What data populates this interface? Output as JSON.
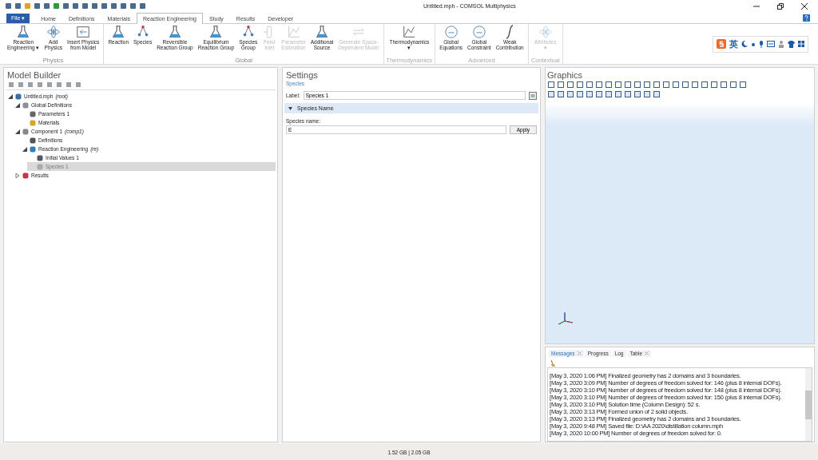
{
  "window": {
    "title": "Untitled.mph - COMSOL Multiphysics"
  },
  "file_button": "File ▾",
  "tabs": [
    {
      "label": "Home",
      "selected": false
    },
    {
      "label": "Definitions",
      "selected": false
    },
    {
      "label": "Materials",
      "selected": false
    },
    {
      "label": "Reaction Engineering",
      "selected": true
    },
    {
      "label": "Study",
      "selected": false
    },
    {
      "label": "Results",
      "selected": false
    },
    {
      "label": "Developer",
      "selected": false
    }
  ],
  "ribbon": [
    {
      "label": "Physics",
      "disabled": false,
      "buttons": [
        {
          "kind": "flask",
          "lines": [
            "Reaction",
            "Engineering ▾"
          ],
          "disabled": false
        },
        {
          "kind": "atom",
          "lines": [
            "Add",
            "Physics"
          ],
          "disabled": false
        },
        {
          "kind": "insert",
          "lines": [
            "Insert Physics",
            "from Model"
          ],
          "disabled": false
        }
      ]
    },
    {
      "label": "Global",
      "disabled": false,
      "buttons": [
        {
          "kind": "flask",
          "lines": [
            "Reaction"
          ],
          "disabled": false
        },
        {
          "kind": "nodes",
          "lines": [
            "Species"
          ],
          "disabled": false
        },
        {
          "kind": "flask",
          "lines": [
            "Reversible",
            "Reaction Group"
          ],
          "disabled": false
        },
        {
          "kind": "flask",
          "lines": [
            "Equilibrium",
            "Reaction Group"
          ],
          "disabled": false
        },
        {
          "kind": "nodes",
          "lines": [
            "Species",
            "Group"
          ],
          "disabled": false
        },
        {
          "kind": "inlet",
          "lines": [
            "Feed",
            "Inlet"
          ],
          "disabled": true
        },
        {
          "kind": "chart",
          "lines": [
            "Parameter",
            "Estimation"
          ],
          "disabled": true
        },
        {
          "kind": "flask",
          "lines": [
            "Additional",
            "Source"
          ],
          "disabled": false
        },
        {
          "kind": "swap",
          "lines": [
            "Generate Space-",
            "Dependent Model"
          ],
          "disabled": true
        }
      ]
    },
    {
      "label": "Thermodynamics",
      "disabled": true,
      "buttons": [
        {
          "kind": "chart",
          "lines": [
            "Thermodynamics",
            "▾"
          ],
          "disabled": false
        }
      ]
    },
    {
      "label": "Advanced",
      "disabled": true,
      "buttons": [
        {
          "kind": "circle",
          "lines": [
            "Global",
            "Equations"
          ],
          "disabled": false
        },
        {
          "kind": "circle",
          "lines": [
            "Global",
            "Constraint"
          ],
          "disabled": false
        },
        {
          "kind": "integral",
          "lines": [
            "Weak",
            "Contribution"
          ],
          "disabled": false
        }
      ]
    },
    {
      "label": "Contextual",
      "disabled": true,
      "buttons": [
        {
          "kind": "atom",
          "lines": [
            "Attributes",
            "▾"
          ],
          "disabled": true
        }
      ]
    }
  ],
  "ime_label": "英",
  "model_builder": {
    "title": "Model Builder",
    "tree": [
      {
        "label": "Untitled.mph",
        "tag": "(root)",
        "kind": "root",
        "selected": false,
        "expanded": true,
        "children": [
          {
            "label": "Global Definitions",
            "kind": "global",
            "selected": false,
            "expanded": true,
            "children": [
              {
                "label": "Parameters 1",
                "kind": "parameters",
                "selected": false
              },
              {
                "label": "Materials",
                "kind": "materials",
                "selected": false
              }
            ]
          },
          {
            "label": "Component 1",
            "tag": "(comp1)",
            "kind": "component",
            "selected": false,
            "expanded": true,
            "children": [
              {
                "label": "Definitions",
                "kind": "definitions",
                "selected": false
              },
              {
                "label": "Reaction Engineering",
                "tag": "(re)",
                "kind": "physics",
                "selected": false,
                "expanded": true,
                "children": [
                  {
                    "label": "Initial Values 1",
                    "kind": "initial",
                    "selected": false
                  },
                  {
                    "label": "Species 1",
                    "kind": "species",
                    "selected": true
                  }
                ]
              }
            ]
          },
          {
            "label": "Results",
            "kind": "results",
            "selected": false,
            "expanded": false
          }
        ]
      }
    ]
  },
  "settings": {
    "title": "Settings",
    "subtitle": "Species",
    "label_caption": "Label:",
    "label_value": "Species 1",
    "section": {
      "title": "Species Name",
      "expanded": true
    },
    "species_caption": "Species name:",
    "species_value": "E",
    "apply": "Apply"
  },
  "graphics": {
    "title": "Graphics"
  },
  "messages": {
    "tabs": [
      {
        "label": "Messages",
        "selected": true,
        "closable": true
      },
      {
        "label": "Progress",
        "selected": false,
        "closable": false
      },
      {
        "label": "Log",
        "selected": false,
        "closable": false
      },
      {
        "label": "Table",
        "selected": false,
        "closable": true
      }
    ],
    "lines": [
      "[May 3, 2020 1:06 PM] Finalized geometry has 2 domains and 3 boundaries.",
      "[May 3, 2020 3:09 PM] Number of degrees of freedom solved for: 146 (plus 8 internal DOFs).",
      "[May 3, 2020 3:10 PM] Number of degrees of freedom solved for: 148 (plus 8 internal DOFs).",
      "[May 3, 2020 3:10 PM] Number of degrees of freedom solved for: 150 (plus 8 internal DOFs).",
      "[May 3, 2020 3:10 PM] Solution time (Column Design): 52 s.",
      "[May 3, 2020 3:13 PM] Formed union of 2 solid objects.",
      "[May 3, 2020 3:13 PM] Finalized geometry has 2 domains and 3 boundaries.",
      "[May 3, 2020 9:48 PM] Saved file: D:\\AA 2020\\distillation column.mph",
      "[May 3, 2020 10:00 PM] Number of degrees of freedom solved for: 0."
    ]
  },
  "status_bar": {
    "memory": "1.52 GB | 2.05 GB"
  }
}
